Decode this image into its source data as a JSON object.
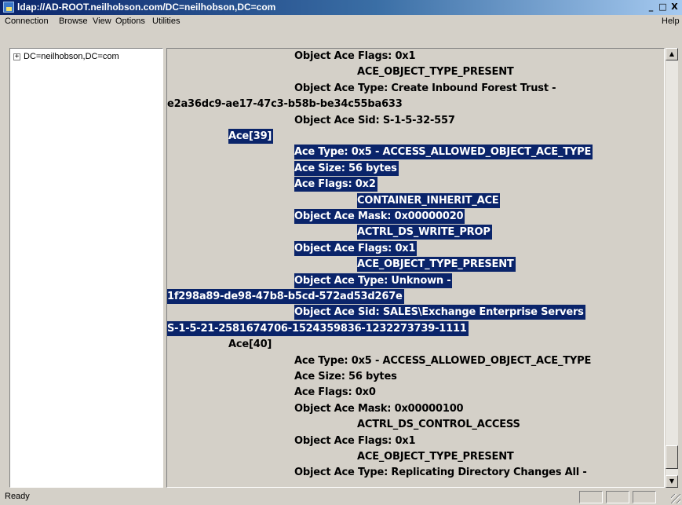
{
  "window": {
    "title": "ldap://AD-ROOT.neilhobson.com/DC=neilhobson,DC=com",
    "buttons": {
      "minimize": "_",
      "maximize": "□",
      "close": "X"
    }
  },
  "menu": {
    "connection": "Connection",
    "browse": "Browse",
    "view": "View",
    "options": "Options",
    "utilities": "Utilities",
    "help": "Help"
  },
  "tree": {
    "expander": "+",
    "root": "DC=neilhobson,DC=com"
  },
  "details": {
    "lines": [
      {
        "text": "Object Ace Flags: 0x1",
        "selected": false
      },
      {
        "text": "ACE_OBJECT_TYPE_PRESENT",
        "selected": false
      },
      {
        "text": "Object Ace Type:  Create Inbound Forest Trust -",
        "selected": false
      },
      {
        "text": "e2a36dc9-ae17-47c3-b58b-be34c55ba633",
        "selected": false
      },
      {
        "text": "Object Ace Sid:   S-1-5-32-557",
        "selected": false
      },
      {
        "text": "Ace[39]",
        "selected": true
      },
      {
        "text": "Ace Type:  0x5 - ACCESS_ALLOWED_OBJECT_ACE_TYPE",
        "selected": true
      },
      {
        "text": "Ace Size:  56 bytes",
        "selected": true
      },
      {
        "text": "Ace Flags: 0x2",
        "selected": true
      },
      {
        "text": "CONTAINER_INHERIT_ACE",
        "selected": true
      },
      {
        "text": "Object Ace Mask:  0x00000020",
        "selected": true
      },
      {
        "text": "ACTRL_DS_WRITE_PROP",
        "selected": true
      },
      {
        "text": "Object Ace Flags: 0x1",
        "selected": true
      },
      {
        "text": "ACE_OBJECT_TYPE_PRESENT",
        "selected": true
      },
      {
        "text": "Object Ace Type:  Unknown -",
        "selected": true
      },
      {
        "text": "1f298a89-de98-47b8-b5cd-572ad53d267e",
        "selected": true
      },
      {
        "text": "Object Ace Sid:   SALES\\Exchange Enterprise Servers",
        "selected": true
      },
      {
        "text": "S-1-5-21-2581674706-1524359836-1232273739-1111",
        "selected": true
      },
      {
        "text": "Ace[40]",
        "selected": false
      },
      {
        "text": "Ace Type:  0x5 - ACCESS_ALLOWED_OBJECT_ACE_TYPE",
        "selected": false
      },
      {
        "text": "Ace Size:  56 bytes",
        "selected": false
      },
      {
        "text": "Ace Flags: 0x0",
        "selected": false
      },
      {
        "text": "Object Ace Mask:  0x00000100",
        "selected": false
      },
      {
        "text": "ACTRL_DS_CONTROL_ACCESS",
        "selected": false
      },
      {
        "text": "Object Ace Flags: 0x1",
        "selected": false
      },
      {
        "text": "ACE_OBJECT_TYPE_PRESENT",
        "selected": false
      },
      {
        "text": "Object Ace Type:  Replicating Directory Changes All -",
        "selected": false
      }
    ]
  },
  "scrollbar": {
    "up": "▲",
    "down": "▼"
  },
  "status": {
    "text": "Ready"
  },
  "colors": {
    "selection": "#0a246a",
    "face": "#d4d0c8"
  }
}
